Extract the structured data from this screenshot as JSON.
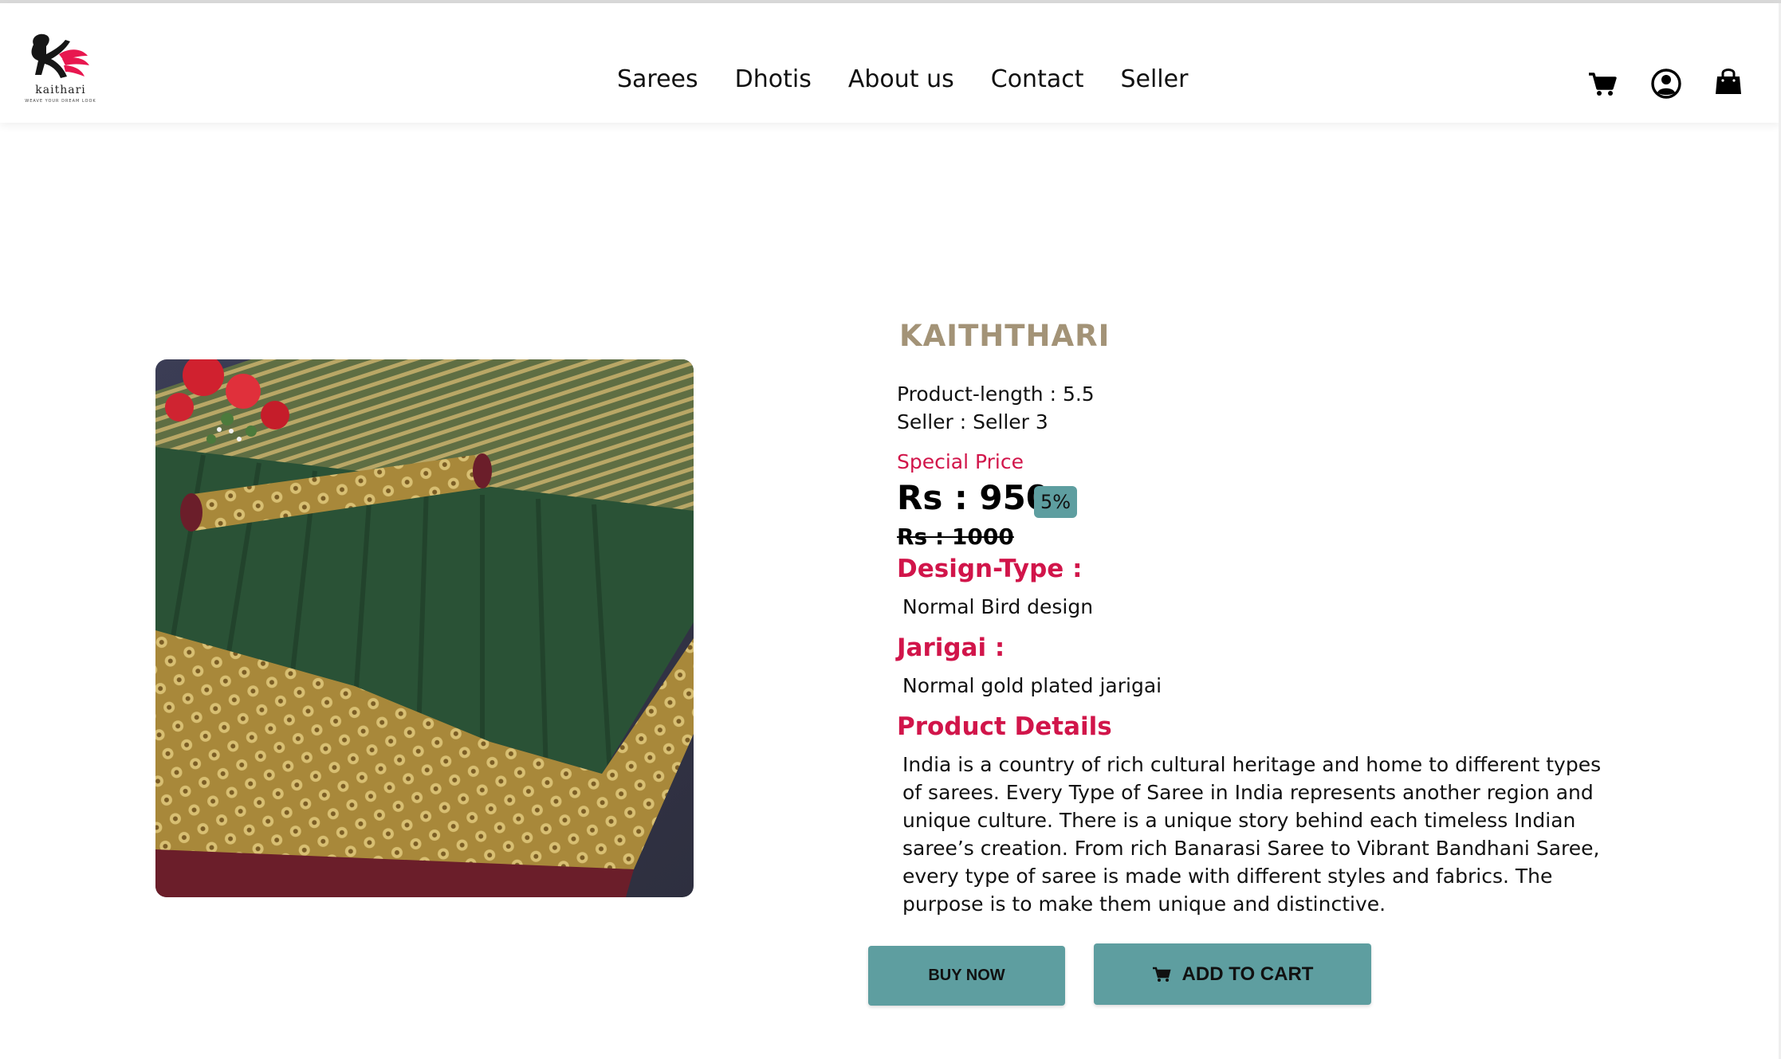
{
  "brand": {
    "logo_text": "kaithari",
    "logo_tagline": "WEAVE YOUR DREAM LOOK",
    "accent_color": "#e8174f"
  },
  "nav": {
    "items": [
      {
        "label": "Sarees"
      },
      {
        "label": "Dhotis"
      },
      {
        "label": "About us"
      },
      {
        "label": "Contact"
      },
      {
        "label": "Seller"
      }
    ]
  },
  "header_icons": [
    "cart-icon",
    "user-icon",
    "shopping-bag-icon"
  ],
  "product": {
    "name": "KAITHTHARI",
    "length_line": "Product-length : 5.5",
    "seller_line": "Seller : Seller 3",
    "special_label": "Special Price",
    "price": "Rs : 950",
    "discount": "5%",
    "old_price": "Rs : 1000",
    "design_title": "Design-Type :",
    "design_value": "Normal Bird design",
    "jarigai_title": "Jarigai :",
    "jarigai_value": "Normal gold plated jarigai",
    "details_title": "Product Details",
    "description": "India is a country of rich cultural heritage and home to different types of sarees. Every Type of Saree in India represents another region and unique culture. There is a unique story behind each timeless Indian saree’s creation. From rich Banarasi Saree to Vibrant Bandhani Saree, every type of saree is made with different styles and fabrics. The purpose is to make them unique and distinctive."
  },
  "actions": {
    "buy_now": "BUY NOW",
    "add_to_cart": "ADD TO CART"
  },
  "colors": {
    "button": "#5e9ea0",
    "heading_red": "#d1154a",
    "brand_gold": "#a39377"
  }
}
